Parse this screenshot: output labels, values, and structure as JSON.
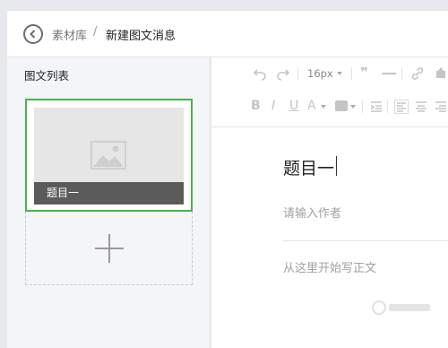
{
  "breadcrumb": {
    "parent": "素材库",
    "separator": "/",
    "current": "新建图文消息"
  },
  "list": {
    "title": "图文列表"
  },
  "card": {
    "caption": "题目一"
  },
  "toolbar": {
    "font_size": "16px"
  },
  "editor": {
    "title": "题目一",
    "author_placeholder": "请输入作者",
    "body_placeholder": "从这里开始写正文"
  },
  "colors": {
    "selected_border": "#44b549"
  }
}
